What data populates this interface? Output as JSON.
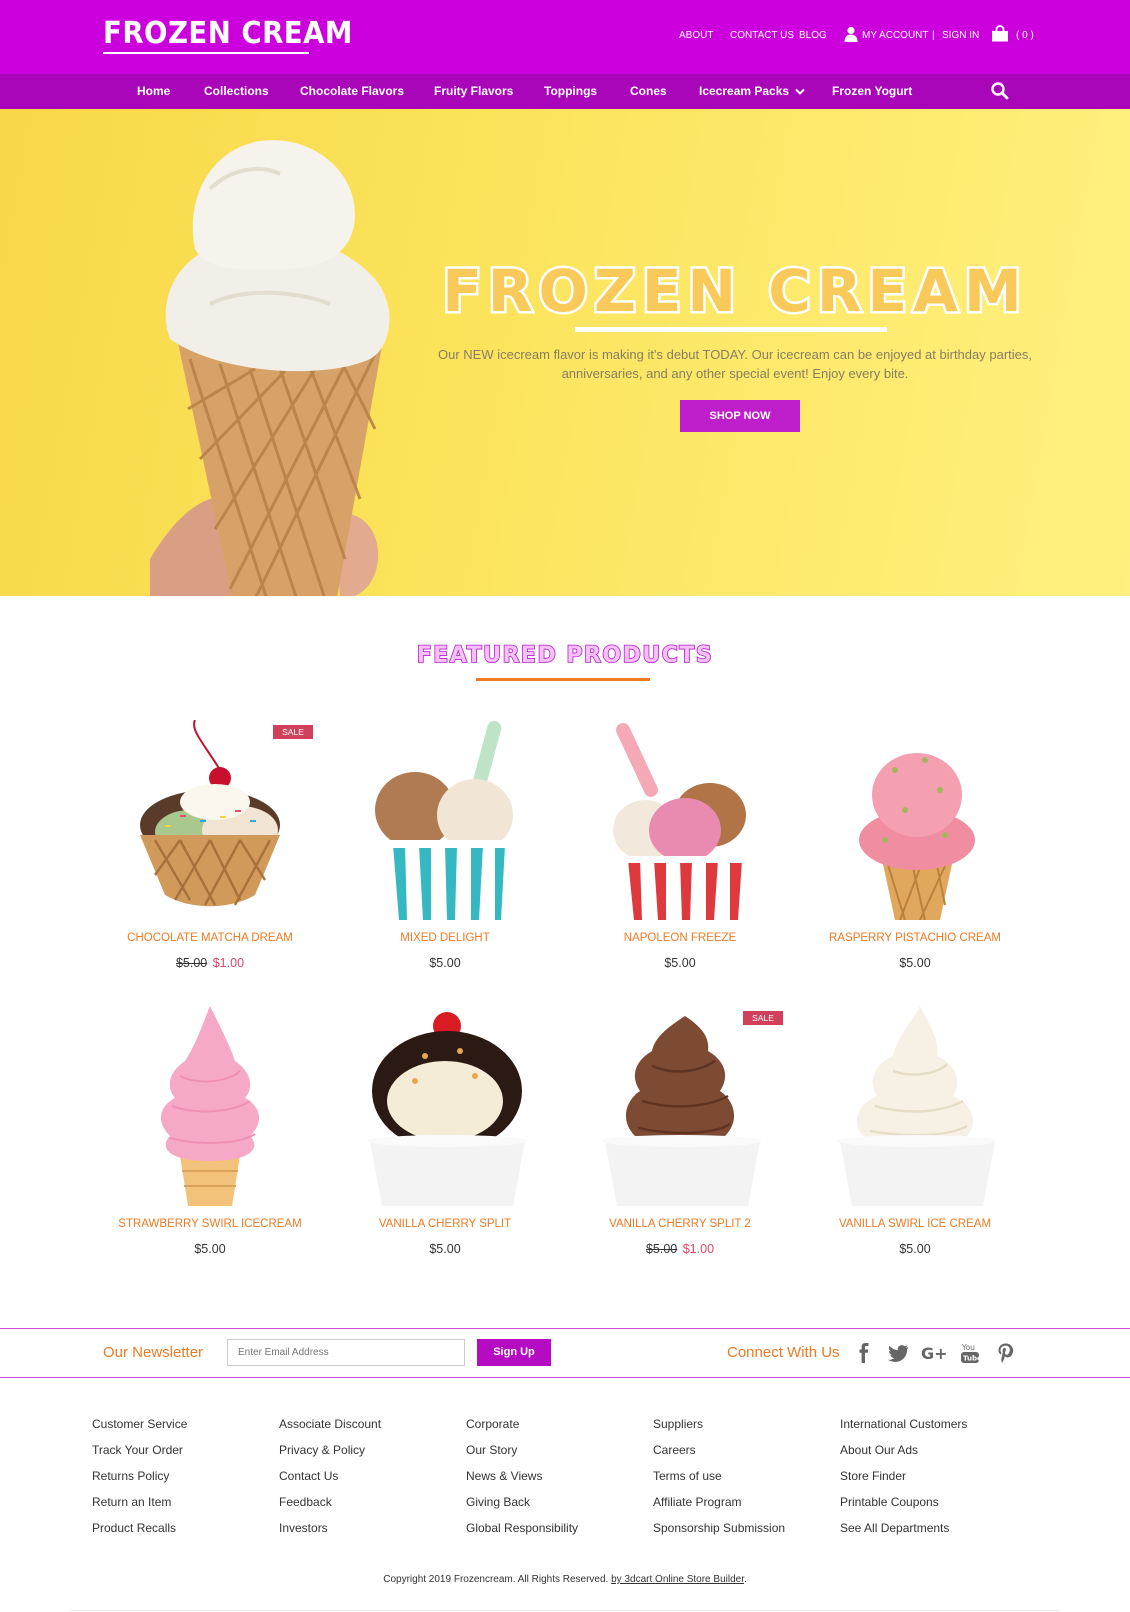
{
  "header": {
    "logo": "FROZEN CREAM",
    "links": {
      "about": "ABOUT",
      "contact": "CONTACT US",
      "blog": "BLOG",
      "account": "MY ACCOUNT",
      "separator": "|",
      "signin": "SIGN IN",
      "cart": "( 0 )"
    },
    "icons": {
      "account": "user-icon",
      "cart": "shopping-bag-icon"
    }
  },
  "nav": {
    "items": [
      "Home",
      "Collections",
      "Chocolate Flavors",
      "Fruity Flavors",
      "Toppings",
      "Cones",
      "Icecream Packs",
      "Frozen Yogurt"
    ],
    "dropdown_icon": "chevron-down-icon",
    "search_icon": "search-icon"
  },
  "hero": {
    "title": "FROZEN CREAM",
    "text": "Our NEW icecream flavor is making it's debut TODAY. Our icecream can be enjoyed at birthday parties, anniversaries, and any other special event! Enjoy every bite.",
    "button": "SHOP NOW"
  },
  "featured": {
    "title": "FEATURED PRODUCTS",
    "products": [
      {
        "name": "CHOCOLATE MATCHA DREAM",
        "old_price": "$5.00",
        "price": "$1.00",
        "sale": "SALE"
      },
      {
        "name": "MIXED DELIGHT",
        "price": "$5.00"
      },
      {
        "name": "NAPOLEON FREEZE",
        "price": "$5.00"
      },
      {
        "name": "RASPERRY PISTACHIO CREAM",
        "price": "$5.00"
      },
      {
        "name": "STRAWBERRY SWIRL ICECREAM",
        "price": "$5.00"
      },
      {
        "name": "VANILLA CHERRY SPLIT",
        "price": "$5.00"
      },
      {
        "name": "VANILLA CHERRY SPLIT 2",
        "old_price": "$5.00",
        "price": "$1.00",
        "sale": "SALE"
      },
      {
        "name": "VANILLA SWIRL ICE CREAM",
        "price": "$5.00"
      }
    ]
  },
  "newsletter": {
    "label": "Our Newsletter",
    "placeholder": "Enter Email Address",
    "button": "Sign Up",
    "connect": "Connect With Us",
    "social_icons": [
      "facebook-icon",
      "twitter-icon",
      "google-plus-icon",
      "youtube-icon",
      "pinterest-icon"
    ]
  },
  "footer": {
    "columns": [
      [
        "Customer Service",
        "Track Your Order",
        "Returns Policy",
        "Return an Item",
        "Product Recalls"
      ],
      [
        "Associate Discount",
        "Privacy & Policy",
        "Contact Us",
        "Feedback",
        "Investors"
      ],
      [
        "Corporate",
        "Our Story",
        "News & Views",
        "Giving Back",
        "Global Responsibility"
      ],
      [
        "Suppliers",
        "Careers",
        "Terms of use",
        "Affiliate Program",
        "Sponsorship Submission"
      ],
      [
        "International Customers",
        "About Our Ads",
        "Store Finder",
        "Printable Coupons",
        "See All Departments"
      ]
    ],
    "copyright": "Copyright 2019 Frozencream. All Rights Reserved.",
    "builder_link": "by 3dcart Online Store Builder",
    "period": "."
  },
  "colors": {
    "header_bg": "#cc00dd",
    "nav_bg": "#aa06b9",
    "accent_orange": "#ef7a22",
    "sale_red": "#d0405b",
    "hero_yellow": "#fbe35a"
  }
}
